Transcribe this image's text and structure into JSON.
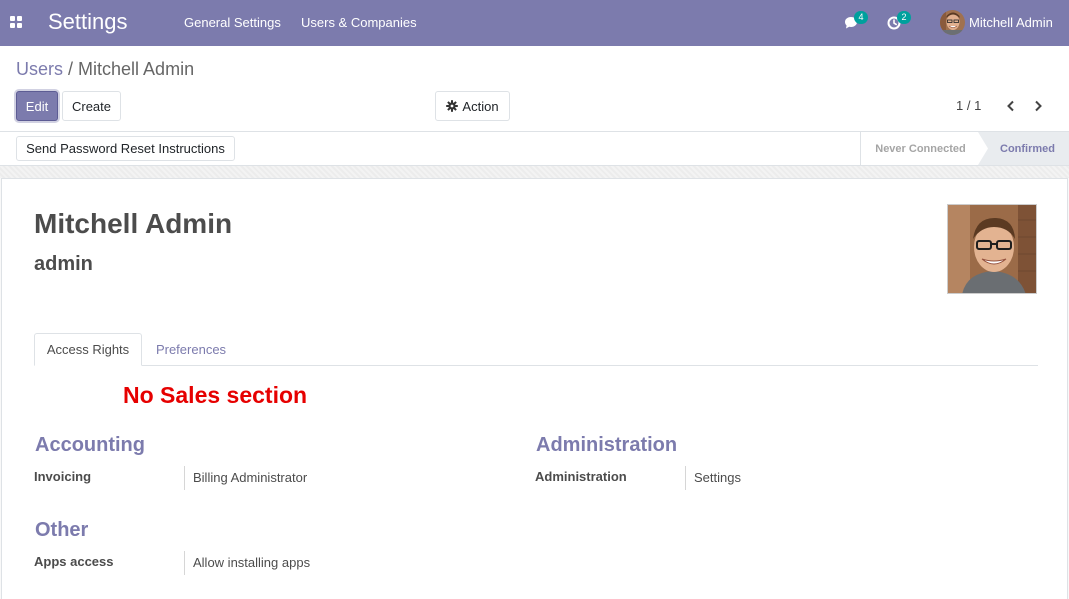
{
  "navbar": {
    "app_title": "Settings",
    "menu": [
      "General Settings",
      "Users & Companies"
    ],
    "messages_count": "4",
    "activities_count": "2",
    "user_name": "Mitchell Admin",
    "color": "#7c7bad"
  },
  "breadcrumb": {
    "parent": "Users",
    "separator": "/",
    "current": "Mitchell Admin"
  },
  "toolbar": {
    "edit_label": "Edit",
    "create_label": "Create",
    "action_label": "Action",
    "pager_value": "1 / 1"
  },
  "statusbar": {
    "reset_button_label": "Send Password Reset Instructions",
    "stages": [
      "Never Connected",
      "Confirmed"
    ],
    "current_stage": "Confirmed"
  },
  "record": {
    "name": "Mitchell Admin",
    "login": "admin"
  },
  "tabs": [
    "Access Rights",
    "Preferences"
  ],
  "active_tab": "Access Rights",
  "annotation": "No Sales section",
  "groups": {
    "accounting": {
      "title": "Accounting",
      "field_label": "Invoicing",
      "field_value": "Billing Administrator"
    },
    "administration": {
      "title": "Administration",
      "field_label": "Administration",
      "field_value": "Settings"
    },
    "other": {
      "title": "Other",
      "field_label": "Apps access",
      "field_value": "Allow installing apps"
    }
  },
  "icons": {
    "apps": "apps-grid-icon",
    "messages": "chat-icon",
    "activities": "clock-icon",
    "action": "gear-icon",
    "pager_prev": "chevron-left-icon",
    "pager_next": "chevron-right-icon"
  }
}
